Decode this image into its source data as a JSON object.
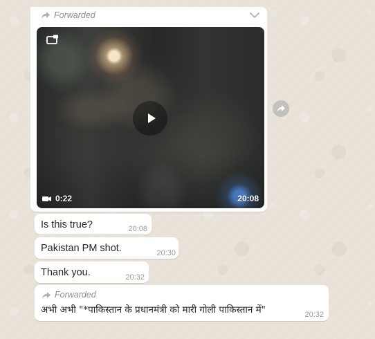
{
  "main_message": {
    "forwarded_label": "Forwarded",
    "video": {
      "duration": "0:22",
      "time": "20:08"
    }
  },
  "messages": [
    {
      "text": "Is this true?",
      "time": "20:08"
    },
    {
      "text": "Pakistan PM shot.",
      "time": "20:30"
    },
    {
      "text": "Thank you.",
      "time": "20:32"
    },
    {
      "forwarded_label": "Forwarded",
      "text": "अभी अभी \"*पाकिस्तान के प्रधानमंत्री को मारी गोली पाकिस्तान में\"",
      "time": "20:32"
    }
  ],
  "icons": {
    "forward": "forward-icon",
    "menu": "chevron-down-icon",
    "expand": "expand-icon",
    "play": "play-icon",
    "camera": "video-camera-icon",
    "share": "share-forward-icon"
  }
}
